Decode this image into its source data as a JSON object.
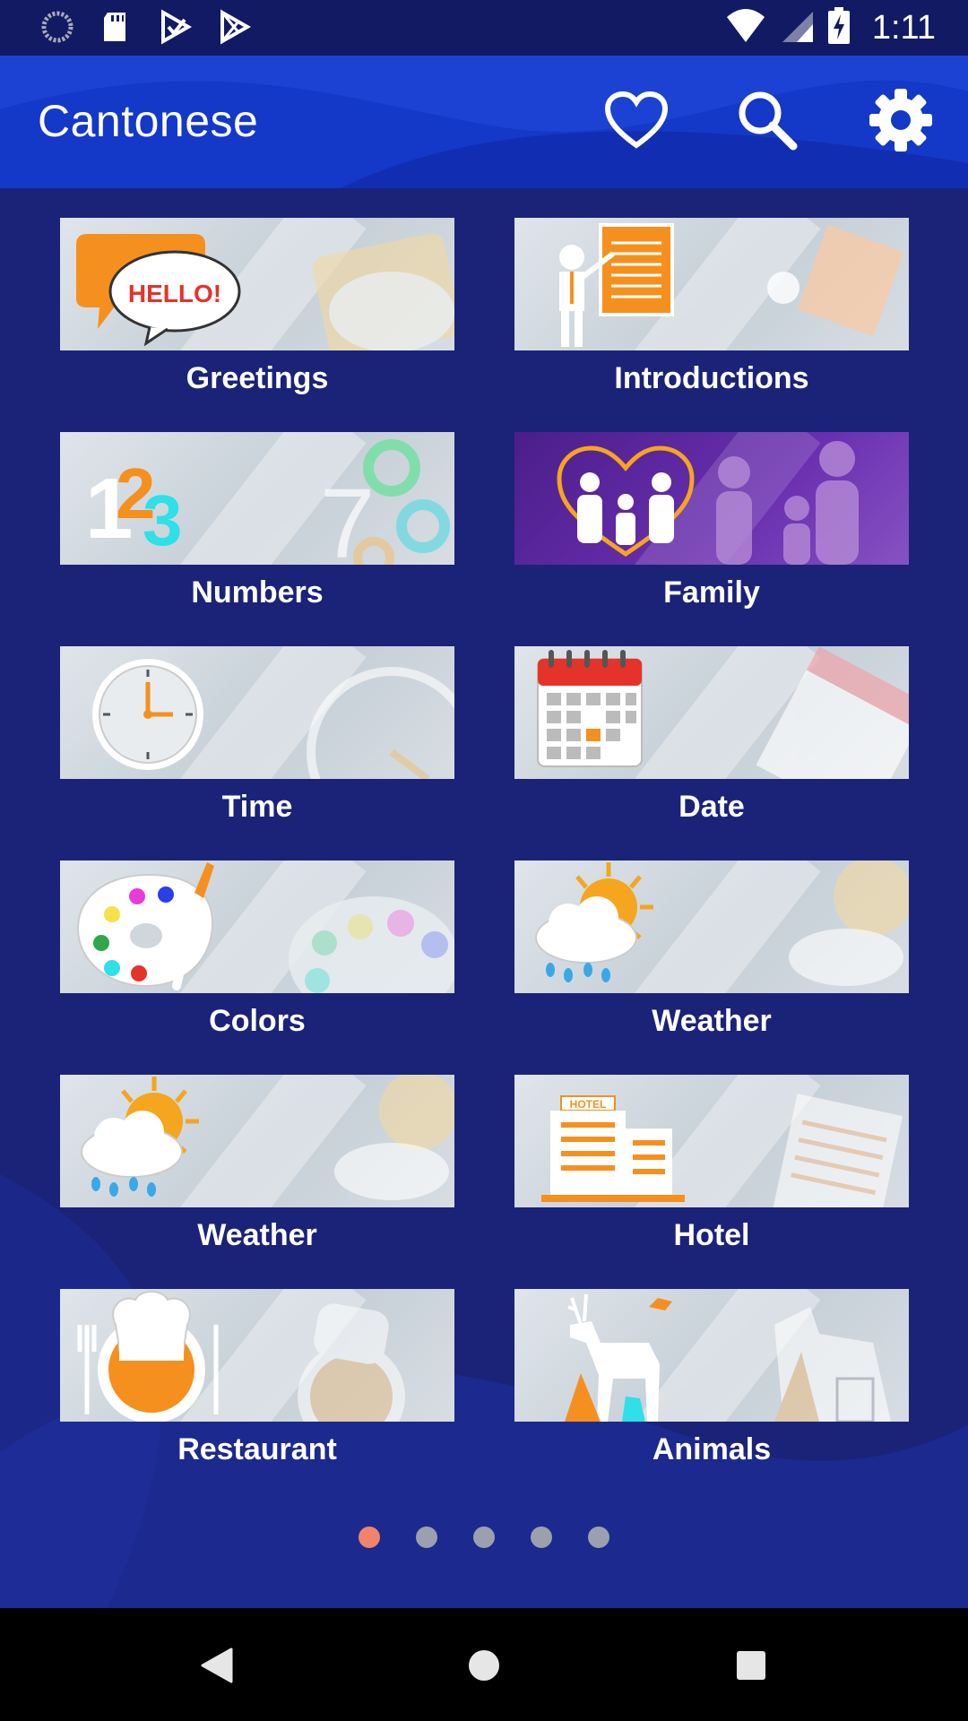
{
  "status_bar": {
    "time": "1:11",
    "left_icons": [
      "loading-icon",
      "sd-card-icon",
      "play-check-icon",
      "play-store-icon"
    ],
    "right_icons": [
      "wifi-icon",
      "signal-icon",
      "battery-charging-icon"
    ]
  },
  "app_bar": {
    "title": "Cantonese",
    "actions": [
      "heart-icon",
      "search-icon",
      "gear-icon"
    ]
  },
  "categories": [
    {
      "label": "Greetings",
      "icon": "hello-speech-bubble"
    },
    {
      "label": "Introductions",
      "icon": "presenter-board"
    },
    {
      "label": "Numbers",
      "icon": "numbers-123"
    },
    {
      "label": "Family",
      "icon": "family-heart"
    },
    {
      "label": "Time",
      "icon": "clock"
    },
    {
      "label": "Date",
      "icon": "calendar"
    },
    {
      "label": "Colors",
      "icon": "paint-palette"
    },
    {
      "label": "Weather",
      "icon": "sun-cloud-rain"
    },
    {
      "label": "Weather",
      "icon": "sun-cloud-rain"
    },
    {
      "label": "Hotel",
      "icon": "hotel-building"
    },
    {
      "label": "Restaurant",
      "icon": "chef-plate"
    },
    {
      "label": "Animals",
      "icon": "deer-animals"
    }
  ],
  "pager": {
    "pages": 5,
    "active": 0
  },
  "colors": {
    "background": "#1a2378",
    "app_bar": "#1438c8",
    "status_bar": "#111a63",
    "accent_orange": "#f0832a",
    "active_dot": "#f0836b"
  }
}
